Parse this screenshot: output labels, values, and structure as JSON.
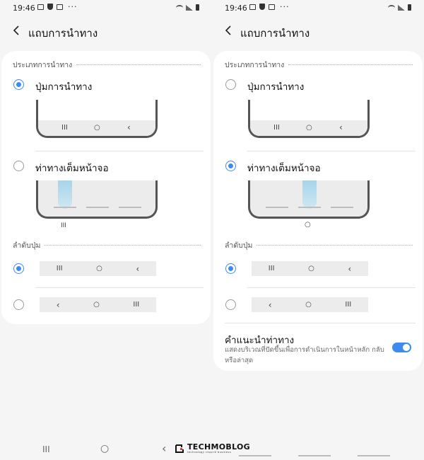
{
  "status": {
    "time": "19:46",
    "more": "···"
  },
  "title": "แถบการนำทาง",
  "nav_type_header": "ประเภทการนำทาง",
  "buttons_option": "ปุ่มการนำทาง",
  "gestures_option": "ท่าทางเต็มหน้าจอ",
  "button_order_header": "ลำดับปุ่ม",
  "nav_glyphs": {
    "recent": "III",
    "home": "○",
    "back": "‹"
  },
  "gesture_hints_title": "คำแนะนำท่าทาง",
  "gesture_hints_desc": "แสดงบริเวณที่ปัดขึ้นเพื่อการดำเนินการในหน้าหลัก กลับ หรือล่าสุด",
  "left_screen": {
    "selected_nav_type": "buttons",
    "selected_order": 0,
    "gesture_hints_visible": false
  },
  "right_screen": {
    "selected_nav_type": "gestures",
    "selected_order": 0,
    "gesture_hints_visible": true,
    "gesture_hints_on": true
  },
  "watermark": {
    "brand": "TECHMOBLOG",
    "tagline": "technology inspire business"
  },
  "colors": {
    "accent": "#3e8bf0",
    "background": "#f5f5f5",
    "card": "#ffffff",
    "glow": "#a7d4ea"
  },
  "icons": [
    "back-arrow-icon",
    "gallery-icon",
    "shield-icon",
    "screenshot-icon",
    "wifi-icon",
    "signal-icon",
    "battery-icon",
    "radio-icon",
    "toggle-icon"
  ]
}
